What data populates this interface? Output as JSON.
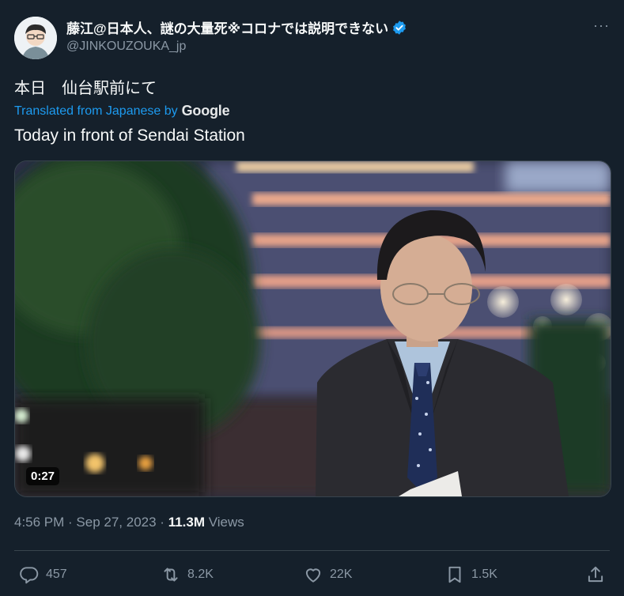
{
  "author": {
    "display_name": "藤江@日本人、謎の大量死※コロナでは説明できない",
    "handle": "@JINKOUZOUKA_jp",
    "avatar_icon": "avatar-icon",
    "verified_icon": "verified-badge-icon"
  },
  "header": {
    "more_label": "···"
  },
  "tweet": {
    "original_text": "本日　仙台駅前にて",
    "translated_label": "Translated from Japanese by",
    "translation_provider": "Google",
    "translated_text": "Today in front of Sendai Station"
  },
  "media": {
    "type": "video",
    "duration": "0:27"
  },
  "meta": {
    "time": "4:56 PM",
    "separator_1": " · ",
    "date": "Sep 27, 2023",
    "separator_2": " · ",
    "views_count": "11.3M",
    "views_label": " Views"
  },
  "actions": {
    "replies": "457",
    "retweets": "8.2K",
    "likes": "22K",
    "bookmarks": "1.5K"
  },
  "colors": {
    "background": "#15202b",
    "accent": "#1d9bf0",
    "secondary_text": "#8b98a5",
    "primary_text": "#f7f9f9"
  }
}
